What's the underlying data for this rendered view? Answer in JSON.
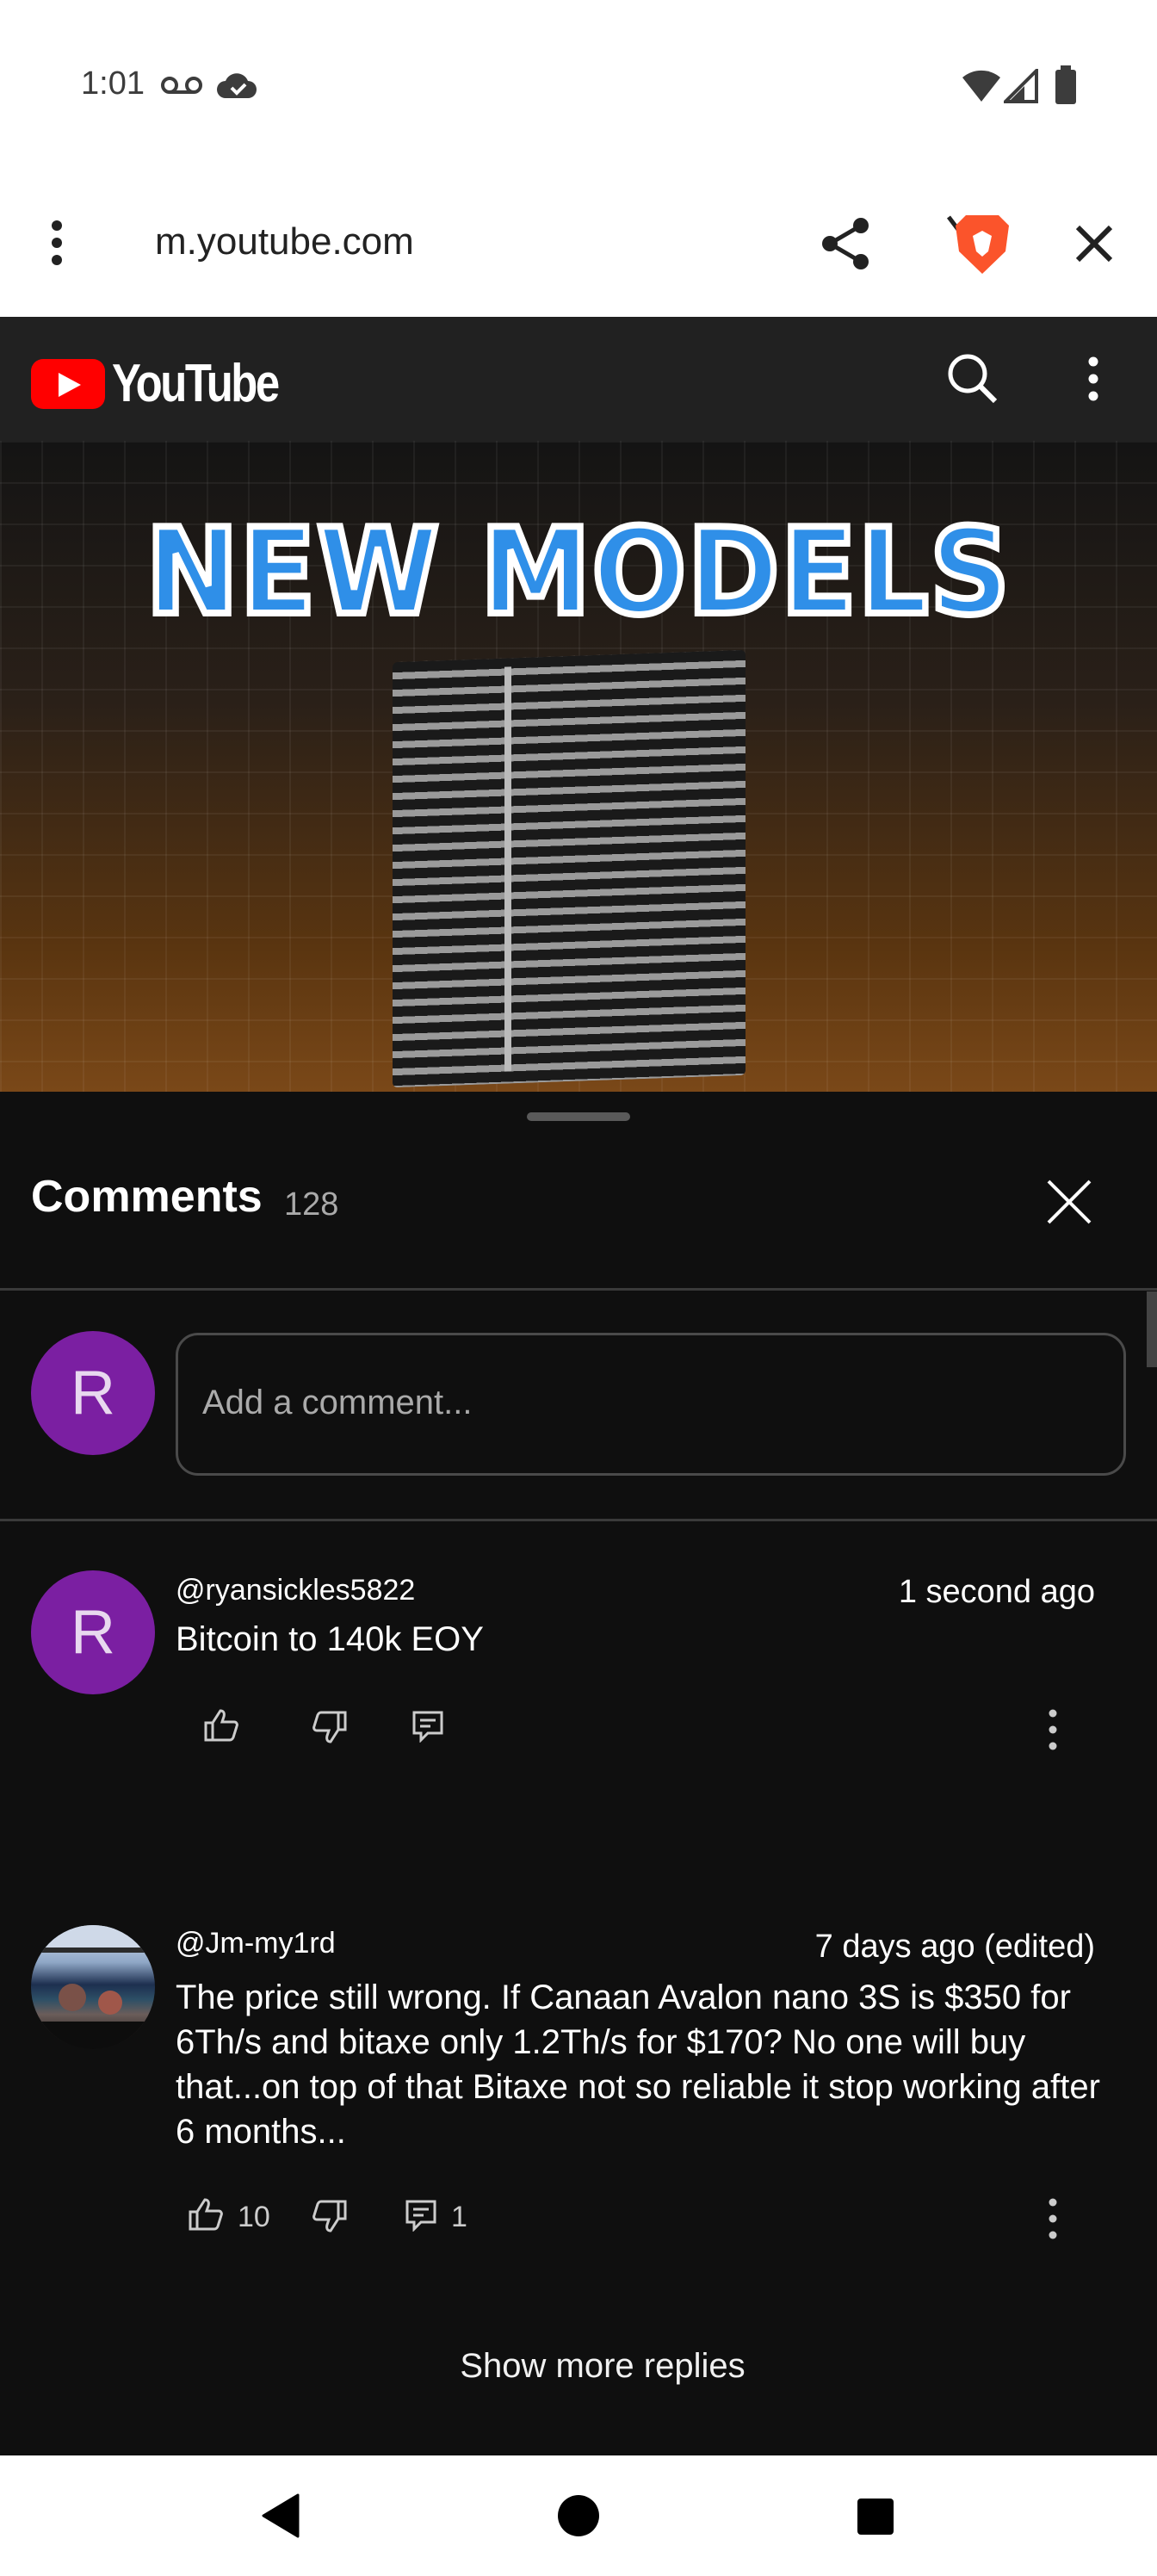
{
  "status_bar": {
    "time": "1:01",
    "icons": [
      "voicemail-icon",
      "cloud-icon",
      "wifi-icon",
      "signal-icon",
      "battery-icon"
    ]
  },
  "browser": {
    "url": "m.youtube.com",
    "icons": [
      "menu-dots-icon",
      "share-icon",
      "brave-shield-icon",
      "close-icon"
    ]
  },
  "youtube_header": {
    "logo_text": "YouTube",
    "icons": [
      "search-icon",
      "more-vert-icon"
    ],
    "brand_color": "#ff0000"
  },
  "video": {
    "overlay_text": "NEW MODELS"
  },
  "comments": {
    "title": "Comments",
    "count": "128",
    "add_avatar_letter": "R",
    "add_placeholder": "Add a comment...",
    "items": [
      {
        "author": "@ryansickles5822",
        "avatar_letter": "R",
        "time": "1 second ago",
        "text": "Bitcoin to 140k EOY",
        "likes": "",
        "replies": ""
      },
      {
        "author": "@Jm-my1rd",
        "avatar_letter": "",
        "time": "7 days ago (edited)",
        "text": "The price still wrong. If Canaan Avalon nano 3S is $350 for 6Th/s and bitaxe only 1.2Th/s for $170? No one will buy that...on top of that Bitaxe not so reliable it stop working after 6 months...",
        "likes": "10",
        "replies": "1"
      }
    ],
    "show_more_label": "Show more replies"
  },
  "nav_bar": {
    "icons": [
      "back-icon",
      "home-icon",
      "recents-icon"
    ]
  }
}
